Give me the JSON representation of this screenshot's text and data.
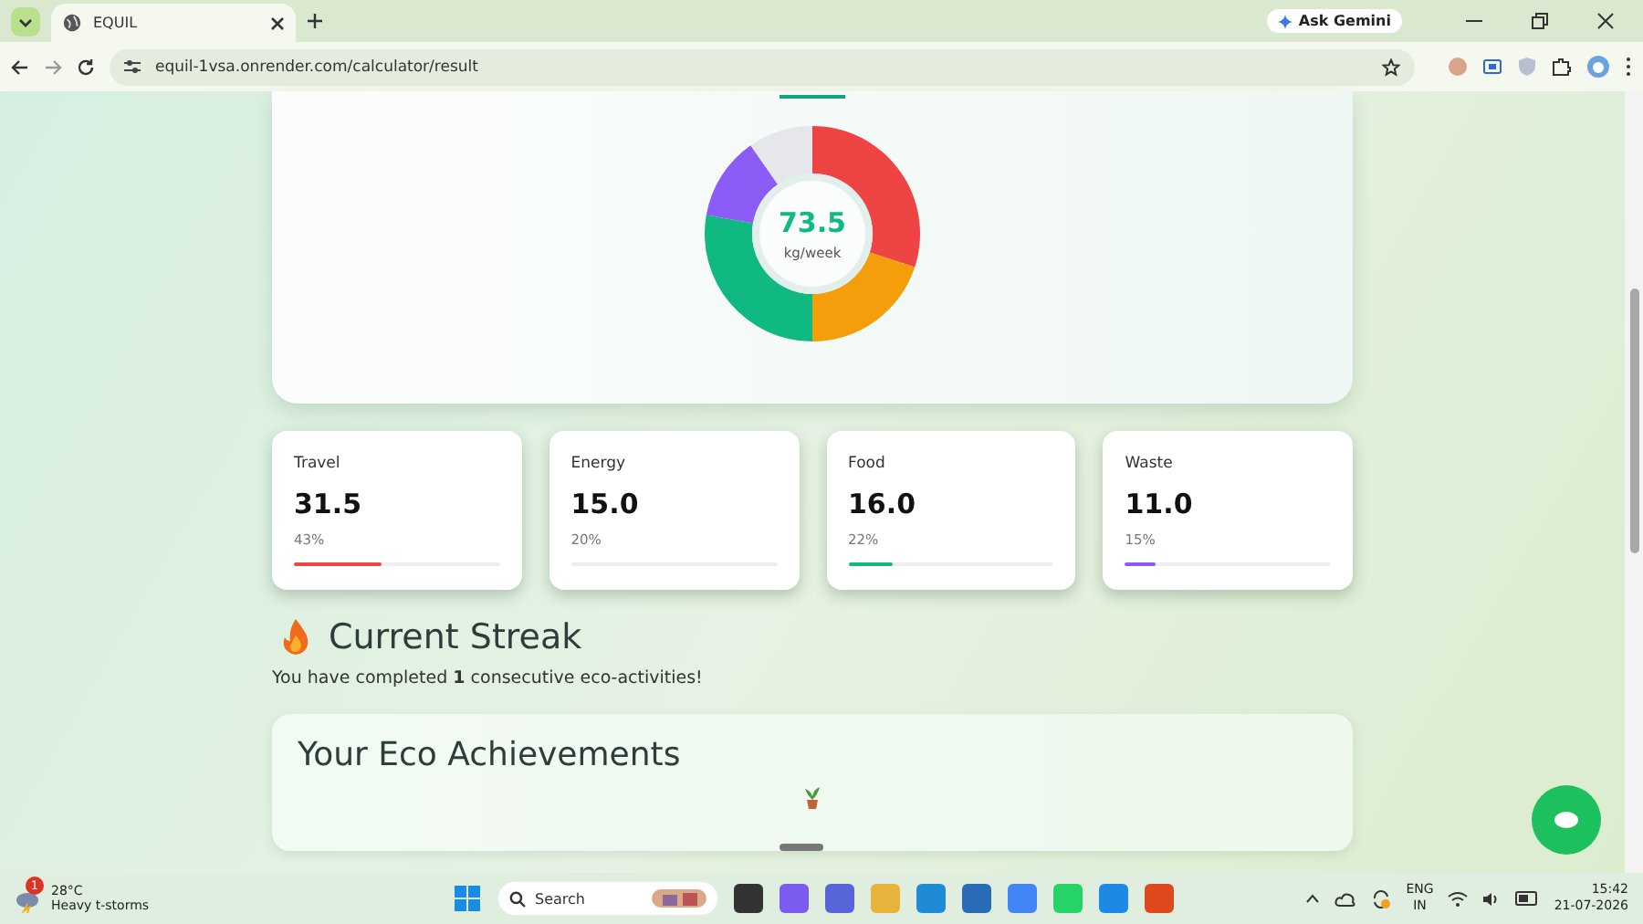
{
  "browser": {
    "tab": {
      "title": "EQUIL"
    },
    "address": "equil-1vsa.onrender.com/calculator/result",
    "gemini_button": "Ask Gemini"
  },
  "summary": {
    "total": "73.5",
    "unit": "kg/week"
  },
  "categories": [
    {
      "name": "Travel",
      "value": "31.5",
      "percent": "43%",
      "level": 0.43,
      "color": "#ef4444"
    },
    {
      "name": "Energy",
      "value": "15.0",
      "percent": "20%"
    },
    {
      "name": "Food",
      "value": "16.0",
      "percent": "22%",
      "level": 0.22,
      "color": "#10b981"
    },
    {
      "name": "Waste",
      "value": "11.0",
      "percent": "15%",
      "level": 0.15,
      "color": "#8b5cf6"
    }
  ],
  "streak": {
    "title": "Current Streak",
    "text": "You have completed **1** consecutive eco-activities!"
  },
  "achievements": {
    "title": "Your Eco Achievements"
  },
  "taskbar": {
    "weather": {
      "temp": "28°C",
      "condition": "Heavy t-storms",
      "badge": "1"
    },
    "search": "Search",
    "language": "ENG",
    "region": "IN",
    "time": "15:42",
    "date": "21-07-2026"
  }
}
